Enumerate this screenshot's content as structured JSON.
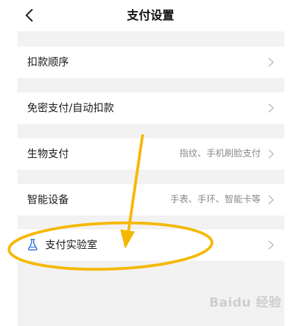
{
  "header": {
    "title": "支付设置",
    "back_icon": "chevron-left-icon"
  },
  "sections": [
    {
      "label": "扣款顺序",
      "value": ""
    },
    {
      "label": "免密支付/自动扣款",
      "value": ""
    },
    {
      "label": "生物支付",
      "value": "指纹、手机刷脸支付"
    },
    {
      "label": "智能设备",
      "value": "手表、手环、智能卡等"
    },
    {
      "label": "支付实验室",
      "value": "",
      "icon": "flask-icon"
    }
  ],
  "annotation": {
    "color": "#F5B800"
  },
  "watermark": {
    "text": "Baidu 经验"
  },
  "colors": {
    "background": "#f2f2f2",
    "cell": "#ffffff",
    "text": "#1a1a1a",
    "secondary_text": "#8a8a8a",
    "chevron": "#b8b8b8",
    "lab_icon": "#2f6fe0"
  }
}
